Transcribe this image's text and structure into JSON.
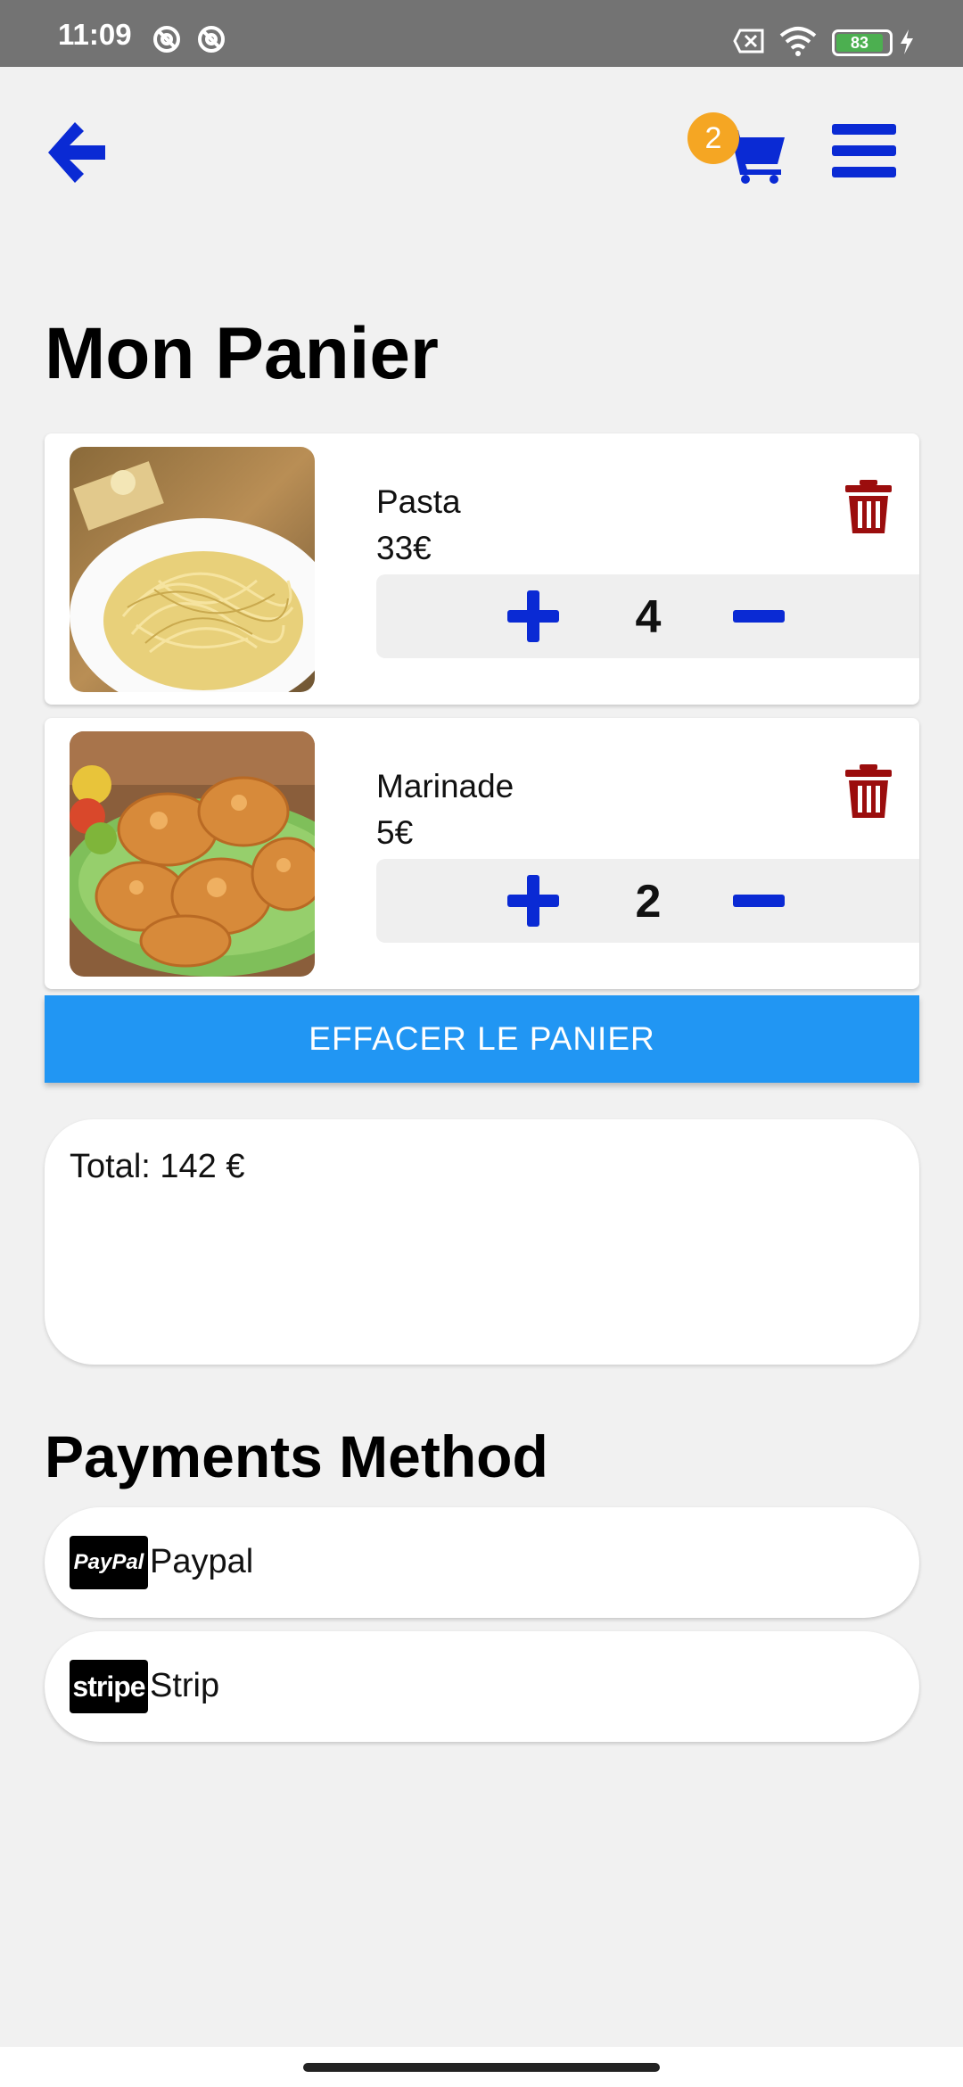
{
  "status_bar": {
    "time": "11:09",
    "battery": "83",
    "icons": [
      "vpn-icon",
      "vpn-icon",
      "sim-off-icon",
      "wifi-icon",
      "battery-icon",
      "charging-icon"
    ]
  },
  "header": {
    "back_icon": "arrow-left-icon",
    "cart_icon": "cart-icon",
    "cart_count": "2",
    "menu_icon": "hamburger-menu-icon",
    "accent_color": "#0a2ad4"
  },
  "page": {
    "title": "Mon Panier"
  },
  "cart": {
    "items": [
      {
        "name": "Pasta",
        "price": "33€",
        "quantity": "4",
        "image": "pasta-spaghetti-photo"
      },
      {
        "name": "Marinade",
        "price": "5€",
        "quantity": "2",
        "image": "fried-chicken-photo"
      }
    ],
    "trash_color": "#9b0d0d",
    "clear_label": "EFFACER LE PANIER",
    "clear_color": "#2196f3"
  },
  "summary": {
    "total_label": "Total: 142 €"
  },
  "payments": {
    "title": "Payments Method",
    "methods": [
      {
        "logo_text": "PayPal",
        "label": "Paypal"
      },
      {
        "logo_text": "stripe",
        "label": "Strip"
      }
    ]
  }
}
